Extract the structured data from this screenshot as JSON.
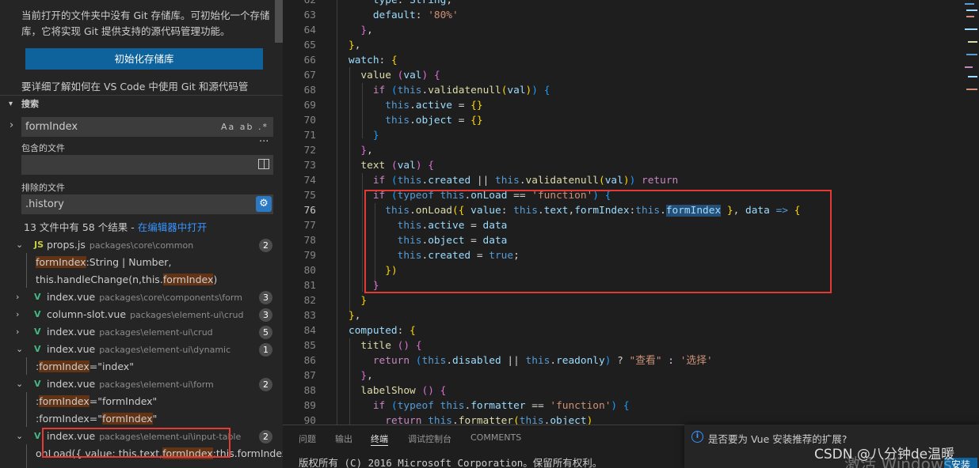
{
  "sidebar": {
    "git_message": "当前打开的文件夹中没有 Git 存储库。可初始化一个存储库，它将实现 Git 提供支持的源代码管理功能。",
    "init_button": "初始化存储库",
    "learn_more": "要详细了解如何在 VS Code 中使用 Git 和源代码管",
    "search": {
      "header": "搜索",
      "query": "formIndex",
      "option_icons": "Aa ab .*",
      "include_label": "包含的文件",
      "include_value": "",
      "exclude_label": "排除的文件",
      "exclude_value": ".history",
      "summary": "13 文件中有 58 个结果 - ",
      "open_in_editor": "在编辑器中打开"
    },
    "results": [
      {
        "name": "props.js",
        "path": "packages\\core\\common",
        "count": "2",
        "icon": "JS",
        "expanded": true
      },
      {
        "name": "index.vue",
        "path": "packages\\core\\components\\form",
        "count": "3",
        "icon": "V",
        "expanded": false
      },
      {
        "name": "column-slot.vue",
        "path": "packages\\element-ui\\crud",
        "count": "3",
        "icon": "V",
        "expanded": false
      },
      {
        "name": "index.vue",
        "path": "packages\\element-ui\\crud",
        "count": "5",
        "icon": "V",
        "expanded": false
      },
      {
        "name": "index.vue",
        "path": "packages\\element-ui\\dynamic",
        "count": "1",
        "icon": "V",
        "expanded": true
      },
      {
        "name": "index.vue",
        "path": "packages\\element-ui\\form",
        "count": "2",
        "icon": "V",
        "expanded": true
      },
      {
        "name": "index.vue",
        "path": "packages\\element-ui\\input-table",
        "count": "2",
        "icon": "V",
        "expanded": true
      }
    ],
    "matches": {
      "props_1_hl": "formIndex",
      "props_1_rest": ":String | Number,",
      "props_2_pre": "this.handleChange(n,this.",
      "props_2_hl": "formIndex",
      "props_2_rest": ")",
      "dynamic_1_pre": ":",
      "dynamic_1_hl": "formIndex",
      "dynamic_1_rest": "=\"index\"",
      "form_1_pre": ":",
      "form_1_hl": "formIndex",
      "form_1_rest": "=\"formIndex\"",
      "form_2_pre": ":formIndex=\"",
      "form_2_hl": "formIndex",
      "form_2_rest": "\"",
      "input_1_pre": "onLoad({ value: this.text,",
      "input_1_hl": "formIndex",
      "input_1_rest": ":this.formIndex }, ..."
    }
  },
  "editor": {
    "line_numbers": [
      "62",
      "63",
      "64",
      "65",
      "66",
      "67",
      "68",
      "69",
      "70",
      "71",
      "72",
      "73",
      "74",
      "75",
      "76",
      "77",
      "78",
      "79",
      "80",
      "81",
      "82",
      "83",
      "84",
      "85",
      "86",
      "87",
      "88",
      "89",
      "90"
    ],
    "active_line": "76"
  },
  "panel": {
    "tabs": [
      "问题",
      "输出",
      "终端",
      "调试控制台",
      "COMMENTS"
    ],
    "active_tab": "终端",
    "terminal_text": "版权所有 (C) 2016 Microsoft Corporation。保留所有权利。"
  },
  "notification": {
    "text": "是否要为 Vue 安装推荐的扩展?",
    "install": "安装"
  },
  "watermark": "CSDN @八分钟de温暖",
  "activation": "激活 Windows",
  "colors": {
    "accent": "#0e639c",
    "highlight_box": "#e53935",
    "match_bg": "#623315"
  }
}
